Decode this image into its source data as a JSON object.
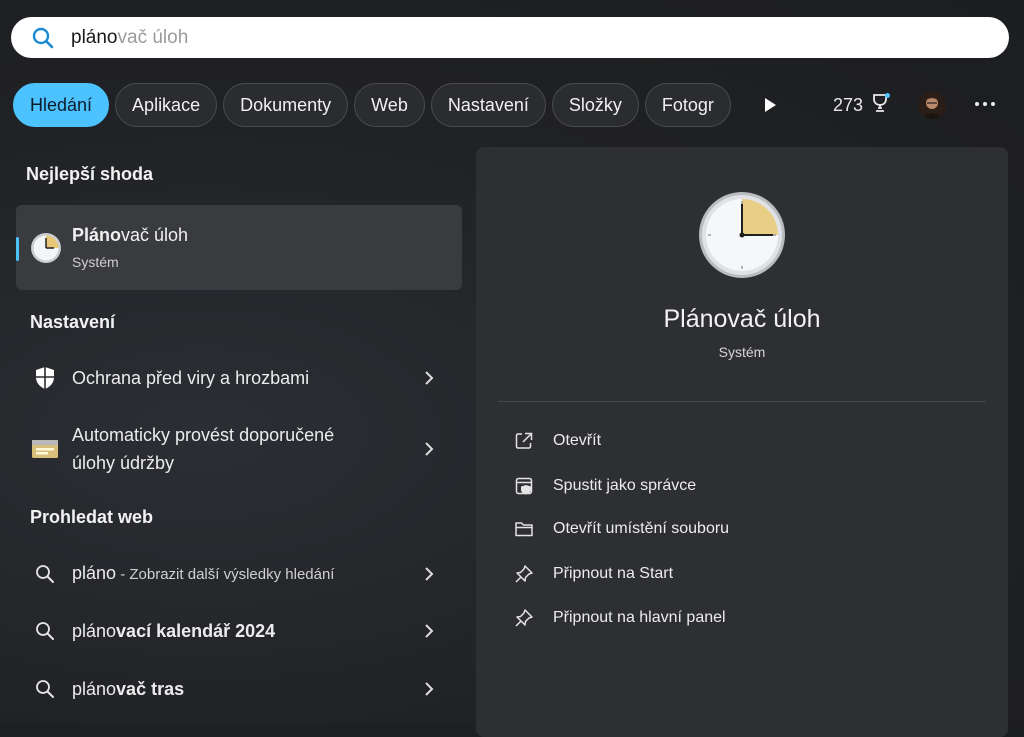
{
  "search": {
    "typed": "pláno",
    "suggestion_rest": "vač úloh",
    "icon": "search-icon"
  },
  "chips": [
    {
      "label": "Hledání",
      "active": true
    },
    {
      "label": "Aplikace"
    },
    {
      "label": "Dokumenty"
    },
    {
      "label": "Web"
    },
    {
      "label": "Nastavení"
    },
    {
      "label": "Složky"
    },
    {
      "label": "Fotogr"
    }
  ],
  "toolbar": {
    "points": "273",
    "points_icon": "trophy-icon",
    "more_icon": "more-icon",
    "play_icon": "play-icon"
  },
  "best_match": {
    "section": "Nejlepší shoda",
    "name_bold": "Pláno",
    "name_rest": "vač úloh",
    "subtitle": "Systém"
  },
  "settings": {
    "section": "Nastavení",
    "items": [
      {
        "label": "Ochrana před viry a hrozbami",
        "icon": "shield-icon"
      },
      {
        "label_line1": "Automaticky provést doporučené",
        "label_line2": "úlohy údržby",
        "icon": "maintenance-icon"
      }
    ]
  },
  "web": {
    "section": "Prohledat web",
    "items": [
      {
        "typed": "pláno",
        "rest": " - Zobrazit další výsledky hledání"
      },
      {
        "typed": "pláno",
        "rest": "vací kalendář 2024"
      },
      {
        "typed": "pláno",
        "rest": "vač tras"
      }
    ]
  },
  "detail": {
    "title": "Plánovač úloh",
    "subtitle": "Systém",
    "actions": [
      {
        "label": "Otevřít",
        "icon": "open-external-icon"
      },
      {
        "label": "Spustit jako správce",
        "icon": "admin-icon"
      },
      {
        "label": "Otevřít umístění souboru",
        "icon": "folder-icon"
      },
      {
        "label": "Připnout na Start",
        "icon": "pin-icon"
      },
      {
        "label": "Připnout na hlavní panel",
        "icon": "pin-icon"
      }
    ]
  },
  "colors": {
    "accent": "#4cc2ff",
    "background": "#202124",
    "panel": "#2e2f33"
  }
}
